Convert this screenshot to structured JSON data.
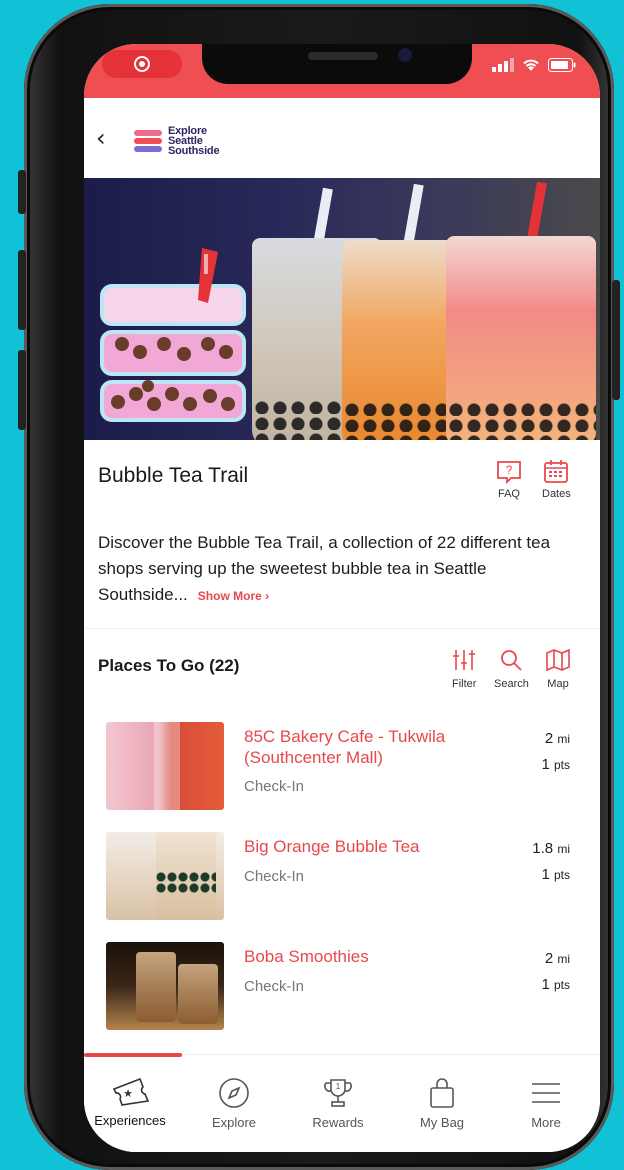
{
  "header": {
    "back_label": "‹",
    "logo_lines": [
      "Explore",
      "Seattle",
      "Southside"
    ]
  },
  "hero": {
    "image": "bubble-tea-cups"
  },
  "trail": {
    "title": "Bubble Tea Trail",
    "faq_label": "FAQ",
    "dates_label": "Dates",
    "description": "Discover the Bubble Tea Trail, a collection of 22 different tea shops serving up the sweetest bubble tea in Seattle Southside...",
    "show_more": "Show More ›"
  },
  "places": {
    "heading": "Places To Go (22)",
    "filter_label": "Filter",
    "search_label": "Search",
    "map_label": "Map",
    "items": [
      {
        "name": "85C Bakery Cafe - Tukwila (Southcenter Mall)",
        "action": "Check-In",
        "distance": "2",
        "distance_unit": "mi",
        "points": "1",
        "points_unit": "pts"
      },
      {
        "name": "Big Orange Bubble Tea",
        "action": "Check-In",
        "distance": "1.8",
        "distance_unit": "mi",
        "points": "1",
        "points_unit": "pts"
      },
      {
        "name": "Boba Smoothies",
        "action": "Check-In",
        "distance": "2",
        "distance_unit": "mi",
        "points": "1",
        "points_unit": "pts"
      }
    ]
  },
  "tabs": [
    {
      "label": "Experiences",
      "icon": "ticket-icon",
      "active": true
    },
    {
      "label": "Explore",
      "icon": "compass-icon"
    },
    {
      "label": "Rewards",
      "icon": "trophy-icon"
    },
    {
      "label": "My Bag",
      "icon": "bag-icon"
    },
    {
      "label": "More",
      "icon": "menu-icon"
    }
  ],
  "colors": {
    "accent": "#e8484c",
    "status_bar": "#ef4e52",
    "background": "#11c2d6",
    "logo_navy": "#2d2664"
  }
}
